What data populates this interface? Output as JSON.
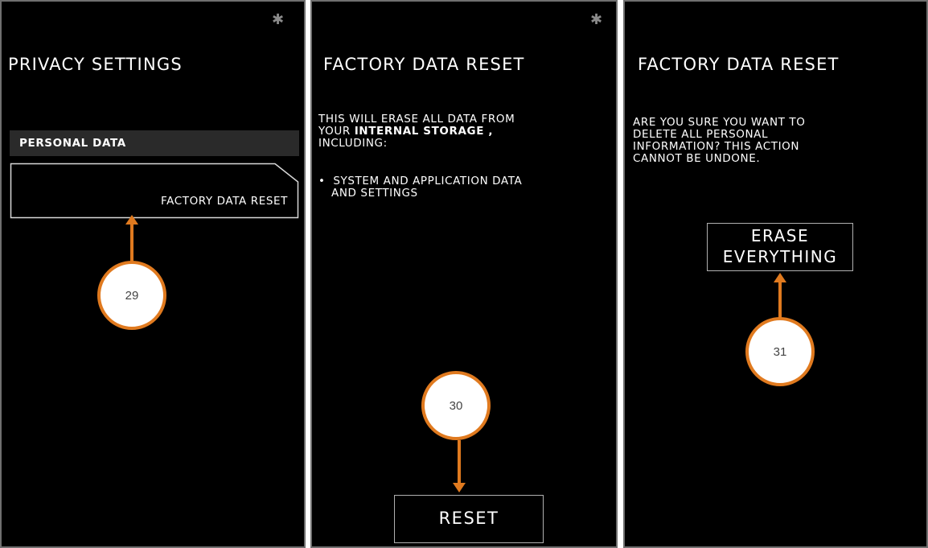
{
  "screens": [
    {
      "title": "PRIVACY SETTINGS",
      "section_header": "PERSONAL DATA",
      "menu_item": "FACTORY DATA RESET",
      "callout": "29"
    },
    {
      "title": "FACTORY DATA RESET",
      "message_line1": "THIS WILL ERASE ALL DATA FROM",
      "message_line2_prefix": "YOUR ",
      "message_line2_bold": "INTERNAL STORAGE ,",
      "message_line3": "INCLUDING:",
      "bullet_line1": "SYSTEM AND APPLICATION DATA",
      "bullet_line2": "AND SETTINGS",
      "button": "RESET",
      "callout": "30"
    },
    {
      "title": "FACTORY DATA RESET",
      "message_line1": "ARE YOU SURE YOU WANT TO",
      "message_line2": "DELETE ALL PERSONAL",
      "message_line3": "INFORMATION? THIS ACTION",
      "message_line4": "CANNOT BE UNDONE.",
      "button_line1": "ERASE",
      "button_line2": "EVERYTHING",
      "callout": "31"
    }
  ],
  "icons": {
    "status": "bluetooth-icon"
  },
  "colors": {
    "callout_accent": "#e07a1f",
    "background": "#000000",
    "section_bg": "#2a2a2a"
  }
}
